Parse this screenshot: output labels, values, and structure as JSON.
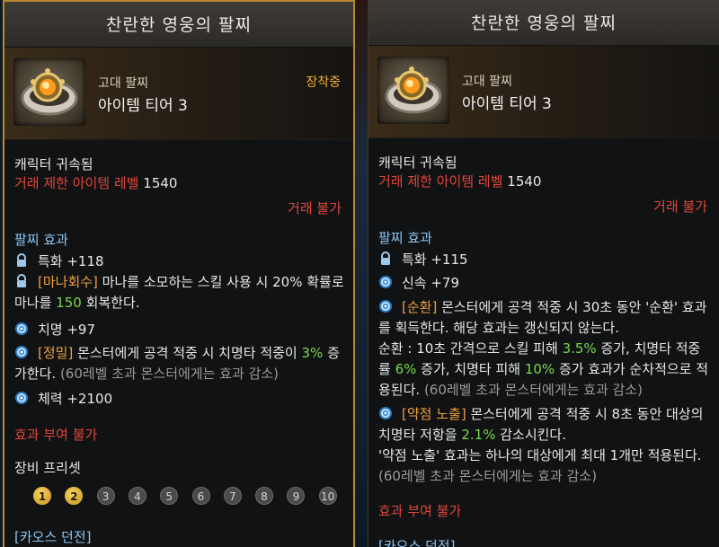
{
  "left": {
    "title": "찬란한 영웅의 팔찌",
    "grade": "고대 팔찌",
    "tier": "아이템 티어 3",
    "equipped": "장착중",
    "bound": "캐릭터 귀속됨",
    "trade_level_label": "거래 제한 아이템 레벨",
    "trade_level_value": "1540",
    "no_trade": "거래 불가",
    "effects_title": "팔찌 효과",
    "effects": [
      {
        "icon": "lock-icon",
        "text": "특화 +118"
      },
      {
        "icon": "lock-icon",
        "tag": "[마나회수]",
        "pre": " 마나를 소모하는 스킬 사용 시 20% 확률로 마나를 ",
        "hl": "150",
        "post": " 회복한다."
      },
      {
        "icon": "swirl-icon",
        "text": "치명 +97"
      },
      {
        "icon": "swirl-icon",
        "tag": "[정밀]",
        "pre": " 몬스터에게 공격 적중 시 치명타 적중이 ",
        "hl": "3%",
        "post": " 증가한다. ",
        "note": "(60레벨 초과 몬스터에게는 효과 감소)"
      },
      {
        "icon": "swirl-icon",
        "text": "체력 +2100"
      }
    ],
    "no_effect": "효과 부여 불가",
    "preset_title": "장비 프리셋",
    "preset_slots": [
      "1",
      "2",
      "3",
      "4",
      "5",
      "6",
      "7",
      "8",
      "9",
      "10"
    ],
    "preset_active": [
      1,
      2
    ],
    "bottom_text": "[카오스 던전]"
  },
  "right": {
    "title": "찬란한 영웅의 팔찌",
    "grade": "고대 팔찌",
    "tier": "아이템 티어 3",
    "bound": "캐릭터 귀속됨",
    "trade_level_label": "거래 제한 아이템 레벨",
    "trade_level_value": "1540",
    "no_trade": "거래 불가",
    "effects_title": "팔찌 효과",
    "effects": [
      {
        "icon": "lock-icon",
        "text": "특화 +115"
      },
      {
        "icon": "swirl-icon",
        "text": "신속 +79"
      },
      {
        "icon": "swirl-icon",
        "tag": "[순환]",
        "pre": " 몬스터에게 공격 적중 시 30초 동안 '순환' 효과를 획득한다. 해당 효과는 갱신되지 않는다.",
        "line2_pre": "순환 : 10초 간격으로 스킬 피해 ",
        "v1": "3.5%",
        "mid1": " 증가, 치명타 적중률 ",
        "v2": "6%",
        "mid2": " 증가, 치명타 피해 ",
        "v3": "10%",
        "post": " 증가 효과가 순차적으로 적용된다. ",
        "note": "(60레벨 초과 몬스터에게는 효과 감소)"
      },
      {
        "icon": "swirl-icon",
        "tag": "[약점 노출]",
        "pre": " 몬스터에게 공격 적중 시 8초 동안 대상의 치명타 저항을 ",
        "hl": "2.1%",
        "post": " 감소시킨다.",
        "line2": "'약점 노출' 효과는 하나의 대상에게 최대 1개만 적용된다. ",
        "note": "(60레벨 초과 몬스터에게는 효과 감소)"
      }
    ],
    "no_effect": "효과 부여 불가",
    "bottom_text": "[카오스 던전]"
  },
  "colors": {
    "frame_gold": "#b8892f",
    "equipped": "#f0b030",
    "red": "#e0463a",
    "blue_heading": "#8cc6f4",
    "highlight_green": "#7bd84b",
    "note_grey": "#9a9a9a",
    "tag_orange": "#f0a040"
  }
}
